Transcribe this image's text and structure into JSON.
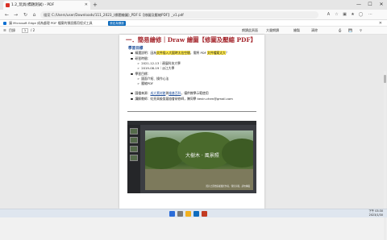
{
  "browser": {
    "tab_title": "1.2_玩具(標題測試) - PDF",
    "new_tab": "+",
    "window_controls": [
      "—",
      "☐",
      "✕"
    ],
    "url_label": "檔案",
    "url": "C:/Users/user/Downloads/111_2023_(標題繪圖)_PDF E【修圖及壓縮PDF】_v1.pdf"
  },
  "notification": {
    "text": "讓 Microsoft Edge 成為處理 PDF 檔案的預設應用程式工具",
    "button": "設定為預設",
    "close": "✕"
  },
  "pdf_toolbar": {
    "contents": "目錄",
    "page_current": "1",
    "page_total": "/ 2",
    "read_aloud": "朗讀此頁面",
    "draw": "大聲朗讀",
    "highlight": "繪製",
    "erase": "清除"
  },
  "page": {
    "title": "一．簡易繪修｜Draw 繪圖【修圖及壓縮 PDF】",
    "section": "學習目標",
    "lines": [
      {
        "label": "精選說明：因為",
        "hl": "文件插入大圖時太佔空間",
        "mid": "，需將 PDF ",
        "hl2": "文件檔案太大",
        "end": "？"
      },
      {
        "label": "研習時間："
      },
      {
        "label": "2021-12-13｜連展科技大學"
      },
      {
        "label": "2019-08-19｜淡江大學"
      },
      {
        "label": "學習目標："
      },
      {
        "label": "圖面介紹、操作心法"
      },
      {
        "label": "壓縮PDF"
      }
    ],
    "source_label": "圖檔來源：",
    "source_link1": "成大素材館",
    "source_and": "與",
    "source_link2": "維基百科",
    "source_end": "，僅供教學示範使用",
    "teacher_label": "講解教師：",
    "teacher": "虹亮高級發展協會研修師，陳同學 kevin.chen@gmail.com",
    "screenshot_watermark": "大樹木 · 風景照",
    "screenshot_caption": "照片之原始版權屬於作者，僅供示範，請勿轉載"
  },
  "taskbar": {
    "time": "下午 03:30",
    "date": "2023/1/30"
  },
  "colors": {
    "title_red": "#a4262c",
    "link_blue": "#1f4e99",
    "highlight_yellow": "#ffe94a",
    "accent_blue": "#0f6cbd"
  }
}
